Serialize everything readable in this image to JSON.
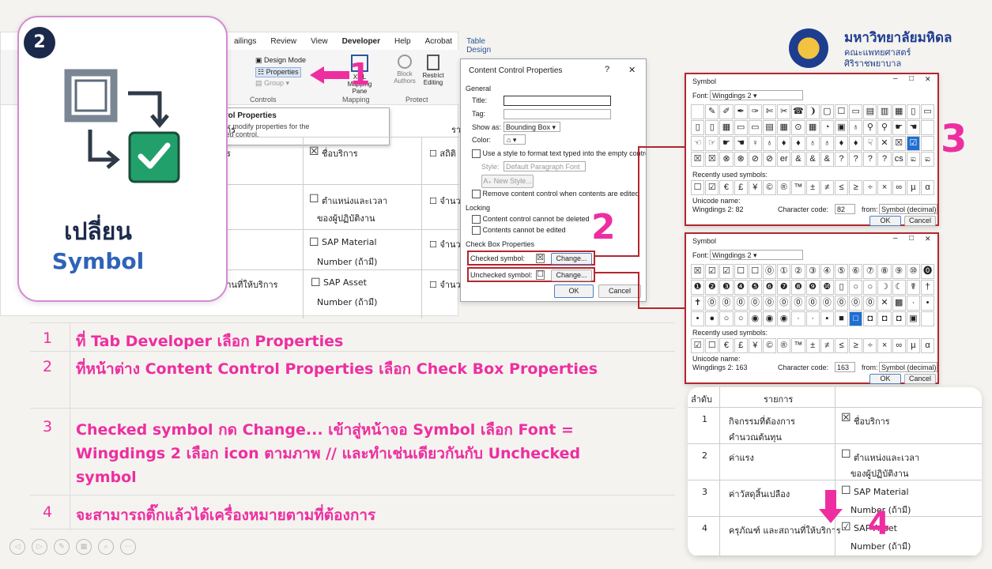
{
  "logo": {
    "line1": "มหาวิทยาลัยมหิดล",
    "line2": "คณะแพทยศาสตร์",
    "line3": "ศิริราชพยาบาล",
    "accent": "#1f3d8f"
  },
  "badge": {
    "number": "2",
    "title": "เปลี่ยน",
    "subtitle": "Symbol"
  },
  "ribbon": {
    "tabs": [
      "ailings",
      "Review",
      "View",
      "Developer",
      "Help",
      "Acrobat",
      "Table Design"
    ],
    "design_mode": "Design Mode",
    "properties": "Properties",
    "group": "Group",
    "controls_group": "Controls",
    "mapping": "XML Mapping Pane",
    "mapping_group": "Mapping",
    "block": "Block Authors",
    "restrict": "Restrict Editing",
    "protect_group": "Protect",
    "tooltip_title": "Control Properties",
    "tooltip_text": "View or modify properties for the selected control."
  },
  "doc": {
    "header_left": "ยการ",
    "header_right": "รา",
    "rows": [
      {
        "left": "การ",
        "check": "☒",
        "item": "ชื่อบริการ",
        "right": "☐ สถิติ"
      },
      {
        "left": "",
        "check": "☐",
        "item": "ตำแหน่งและเวลา",
        "item2": "ของผู้ปฏิบัติงาน",
        "right": "☐ จำนว"
      },
      {
        "left": "อง",
        "check": "☐",
        "item": "SAP Material",
        "item2": "Number (ถ้ามี)",
        "right": "☐ จำนว"
      },
      {
        "left": "สถานที่ให้บริการ",
        "check": "☐",
        "item": "SAP Asset",
        "item2": "Number (ถ้ามี)",
        "right": "☐ จำนว"
      }
    ]
  },
  "ccp": {
    "title": "Content Control Properties",
    "help": "?",
    "close": "✕",
    "general": "General",
    "title_label": "Title:",
    "tag_label": "Tag:",
    "showas_label": "Show as:",
    "showas_value": "Bounding Box",
    "color_label": "Color:",
    "use_style": "Use a style to format text typed into the empty control",
    "style_label": "Style:",
    "style_value": "Default Paragraph Font",
    "new_style": "New Style...",
    "remove": "Remove content control when contents are edited",
    "locking": "Locking",
    "lock1": "Content control cannot be deleted",
    "lock2": "Contents cannot be edited",
    "cbp": "Check Box Properties",
    "checked_label": "Checked symbol:",
    "unchecked_label": "Unchecked symbol:",
    "change": "Change...",
    "ok": "OK",
    "cancel": "Cancel"
  },
  "sym1": {
    "title": "Symbol",
    "font_label": "Font:",
    "font_value": "Wingdings 2",
    "grid": [
      [
        "",
        "✎",
        "✐",
        "✒",
        "✑",
        "✄",
        "✂",
        "☎",
        "❩",
        "▢",
        "☐",
        "▭",
        "▤",
        "▥",
        "▦",
        "▯",
        "▭"
      ],
      [
        "▯",
        "▯",
        "▦",
        "▭",
        "▭",
        "▤",
        "▦",
        "⊙",
        "▦",
        "◔",
        "▣",
        "♁",
        "⚲",
        "⚲",
        "☛",
        "☚",
        ""
      ],
      [
        "☜",
        "☞",
        "☛",
        "☚",
        "♀",
        "♁",
        "♦",
        "♦",
        "♁",
        "♁",
        "♦",
        "♦",
        "☟",
        "✕",
        "☒",
        "☑",
        ""
      ],
      [
        "☒",
        "☒",
        "⊗",
        "⊗",
        "⊘",
        "⊘",
        "er",
        "&",
        "&",
        "&",
        "?",
        "?",
        "?",
        "?",
        "cs",
        "ಐ",
        "ಐ"
      ]
    ],
    "recent_label": "Recently used symbols:",
    "recent": [
      "☐",
      "☑",
      "€",
      "£",
      "¥",
      "©",
      "®",
      "™",
      "±",
      "≠",
      "≤",
      "≥",
      "÷",
      "×",
      "∞",
      "µ",
      "α"
    ],
    "unicode_label": "Unicode name:",
    "unicode_value": "Wingdings 2: 82",
    "code_label": "Character code:",
    "code_value": "82",
    "from_label": "from:",
    "from_value": "Symbol (decimal)",
    "ok": "OK",
    "cancel": "Cancel"
  },
  "sym2": {
    "title": "Symbol",
    "font_label": "Font:",
    "font_value": "Wingdings 2",
    "grid": [
      [
        "☒",
        "☑",
        "☑",
        "☐",
        "☐",
        "⓪",
        "①",
        "②",
        "③",
        "④",
        "⑤",
        "⑥",
        "⑦",
        "⑧",
        "⑨",
        "⑩",
        "⓿"
      ],
      [
        "❶",
        "❷",
        "❸",
        "❹",
        "❺",
        "❻",
        "❼",
        "❽",
        "❾",
        "❿",
        "▯",
        "○",
        "○",
        "☽",
        "☾",
        "☤",
        "†"
      ],
      [
        "✝",
        "⓪",
        "⓪",
        "⓪",
        "⓪",
        "⓪",
        "⓪",
        "⓪",
        "⓪",
        "⓪",
        "⓪",
        "⓪",
        "⓪",
        "✕",
        "▩",
        "·",
        "•"
      ],
      [
        "•",
        "●",
        "○",
        "○",
        "◉",
        "◉",
        "◉",
        "·",
        "·",
        "▪",
        "■",
        "□",
        "◘",
        "◘",
        "◘",
        "▣",
        ""
      ]
    ],
    "recent_label": "Recently used symbols:",
    "recent": [
      "☑",
      "☐",
      "€",
      "£",
      "¥",
      "©",
      "®",
      "™",
      "±",
      "≠",
      "≤",
      "≥",
      "÷",
      "×",
      "∞",
      "µ",
      "α"
    ],
    "unicode_label": "Unicode name:",
    "unicode_value": "Wingdings 2: 163",
    "code_label": "Character code:",
    "code_value": "163",
    "from_label": "from:",
    "from_value": "Symbol (decimal)",
    "ok": "OK",
    "cancel": "Cancel"
  },
  "markers": {
    "m1": "1",
    "m2": "2",
    "m3": "3",
    "m4": "4"
  },
  "steps": [
    {
      "num": "1",
      "text": "ที่ Tab Developer เลือก Properties"
    },
    {
      "num": "2",
      "text": "ที่หน้าต่าง Content Control Properties เลือก Check Box Properties"
    },
    {
      "num": "3",
      "text": "Checked symbol กด Change... เข้าสู่หน้าจอ Symbol เลือก Font = Wingdings 2 เลือก icon ตามภาพ // และทำเช่นเดียวกันกับ Unchecked symbol"
    },
    {
      "num": "4",
      "text": "จะสามารถติ๊กแล้วได้เครื่องหมายตามที่ต้องการ"
    }
  ],
  "result": {
    "h1": "ลำดับ",
    "h2": "รายการ",
    "rows": [
      {
        "n": "1",
        "a": "กิจกรรมที่ต้องการ",
        "a2": "คำนวณต้นทุน",
        "check": "☒",
        "b": "ชื่อบริการ",
        "b2": ""
      },
      {
        "n": "2",
        "a": "ค่าแรง",
        "a2": "",
        "check": "☐",
        "b": "ตำแหน่งและเวลา",
        "b2": "ของผู้ปฏิบัติงาน"
      },
      {
        "n": "3",
        "a": "ค่าวัสดุสิ้นเปลือง",
        "a2": "",
        "check": "☐",
        "b": "SAP Material",
        "b2": "Number (ถ้ามี)"
      },
      {
        "n": "4",
        "a": "ครุภัณฑ์ และสถานที่ให้บริการ",
        "a2": "",
        "check": "☑",
        "b": "SAP Asset",
        "b2": "Number (ถ้ามี)"
      }
    ]
  },
  "colors": {
    "pink": "#ee2ea0",
    "purple": "#6b3fa0",
    "green": "#22a06b",
    "red": "#b3262f"
  }
}
